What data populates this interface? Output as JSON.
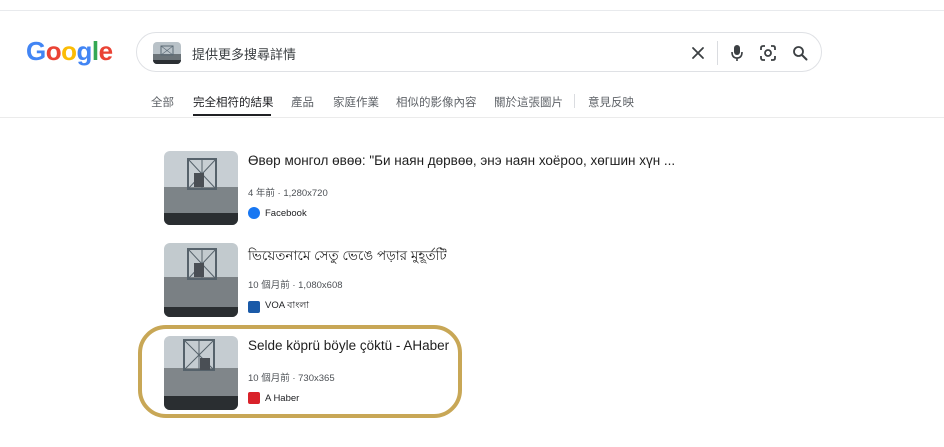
{
  "logo": {
    "letters": [
      "G",
      "o",
      "o",
      "g",
      "l",
      "e"
    ]
  },
  "search": {
    "placeholder": "提供更多搜尋詳情",
    "value": ""
  },
  "icons": {
    "clear": "close-icon",
    "mic": "mic-icon",
    "lens": "lens-icon",
    "search": "search-icon"
  },
  "tabs": [
    {
      "label": "全部"
    },
    {
      "label": "完全相符的結果"
    },
    {
      "label": "產品"
    },
    {
      "label": "家庭作業"
    },
    {
      "label": "相似的影像內容"
    },
    {
      "label": "關於這張圖片"
    },
    {
      "label": "意見反映"
    }
  ],
  "active_tab": "完全相符的結果",
  "results": [
    {
      "title": "Өвөр монгол өвөө: \"Би наян дөрвөө, энэ наян хоёроо, хөгшин хүн ...",
      "meta": "4 年前 · 1,280x720",
      "source": "Facebook"
    },
    {
      "title": "ভিয়েতনামে সেতু ভেঙে পড়ার মুহূর্তটি",
      "meta": "10 個月前 · 1,080x608",
      "source": "VOA বাংলা"
    },
    {
      "title": "Selde köprü böyle çöktü - AHaber",
      "meta": "10 個月前 · 730x365",
      "source": "A Haber"
    }
  ],
  "colors": {
    "accent_highlight": "#c8a756",
    "google_blue": "#4285f4",
    "google_red": "#ea4335",
    "google_yellow": "#fbbc05",
    "google_green": "#34a853"
  }
}
